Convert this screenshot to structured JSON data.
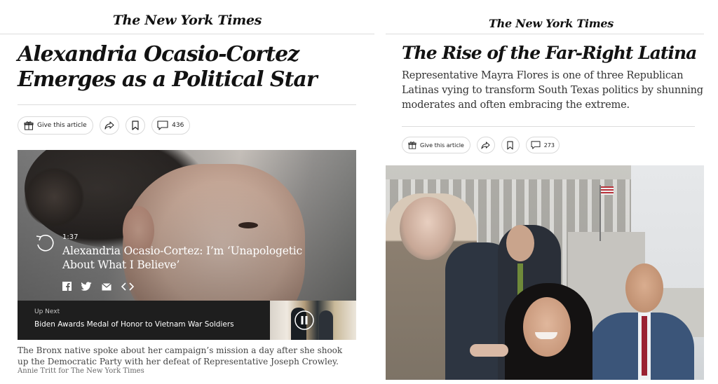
{
  "left": {
    "masthead": "The New York Times",
    "headline": "Alexandria Ocasio-Cortez Emerges as a Political Star",
    "toolbar": {
      "gift_label": "Give this article",
      "comment_count": "436"
    },
    "video": {
      "duration": "1:37",
      "title": "Alexandria Ocasio-Cortez: I’m ‘Unapologetic About What I Believe’",
      "share_icons": [
        "facebook-icon",
        "twitter-icon",
        "email-icon",
        "embed-icon"
      ],
      "up_next_label": "Up Next",
      "up_next_title": "Biden Awards Medal of Honor to Vietnam War Soldiers"
    },
    "caption": "The Bronx native spoke about her campaign’s mission a day after she shook up the Democratic Party with her defeat of Representative Joseph Crowley.",
    "credit": "Annie Tritt for The New York Times"
  },
  "right": {
    "masthead": "The New York Times",
    "headline": "The Rise of the Far-Right Latina",
    "summary": "Representative Mayra Flores is one of three Republican Latinas vying to transform South Texas politics by shunning moderates and often embracing the extreme.",
    "toolbar": {
      "gift_label": "Give this article",
      "comment_count": "273"
    }
  },
  "colors": {
    "text": "#121212",
    "rule": "#dcdcdc",
    "up_next_bg": "#1e1e1e"
  }
}
